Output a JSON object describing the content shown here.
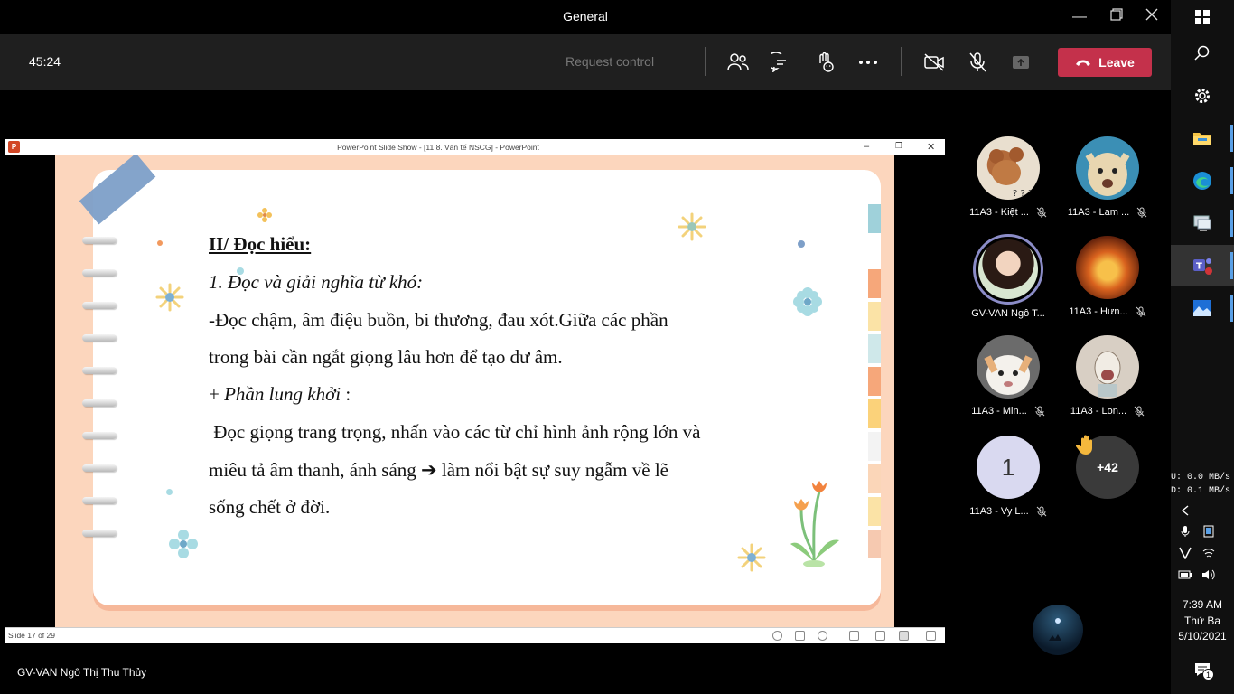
{
  "window": {
    "title": "General"
  },
  "meeting": {
    "timer": "45:24",
    "request_control": "Request control",
    "leave_label": "Leave",
    "presenter_name": "GV-VAN Ngô Thị Thu Thủy"
  },
  "ppt": {
    "title": "PowerPoint Slide Show - [11.8. Văn tế NSCG] - PowerPoint",
    "status": "Slide 17 of 29"
  },
  "slide": {
    "heading": "II/ Đọc hiểu:",
    "sub1": "1. Đọc và giải nghĩa từ khó:",
    "line1": "-Đọc chậm, âm điệu buồn, bi thương, đau xót.Giữa các phần",
    "line2": "trong bài cần ngắt giọng lâu hơn để tạo dư âm.",
    "sub2_prefix": "+ ",
    "sub2": "Phần lung khởi",
    "sub2_suffix": " :",
    "line3": " Đọc giọng trang trọng, nhấn vào các từ chỉ hình ảnh rộng lớn và",
    "line4_a": "miêu tả âm thanh, ánh sáng ",
    "line4_arrow": "➔",
    "line4_b": " làm nổi bật sự suy ngẫm về lẽ",
    "line5": "sống chết ở đời."
  },
  "participants": [
    {
      "name": "11A3 - Kiệt ..."
    },
    {
      "name": "11A3 - Lam ..."
    },
    {
      "name": "GV-VAN Ngô T..."
    },
    {
      "name": "11A3 - Hưn..."
    },
    {
      "name": "11A3 - Min..."
    },
    {
      "name": "11A3 - Lon..."
    },
    {
      "name": "11A3 - Vy L...",
      "initial": "1"
    }
  ],
  "more_participants": "+42",
  "taskbar": {
    "net_up": "U:    0.0 MB/s",
    "net_down": "D:    0.1 MB/s",
    "time": "7:39 AM",
    "day": "Thứ Ba",
    "date": "5/10/2021",
    "notif_count": "1"
  },
  "colors": {
    "leave": "#c4314b",
    "control_bar": "#1f1f1f",
    "accent": "#5aa0e6"
  }
}
